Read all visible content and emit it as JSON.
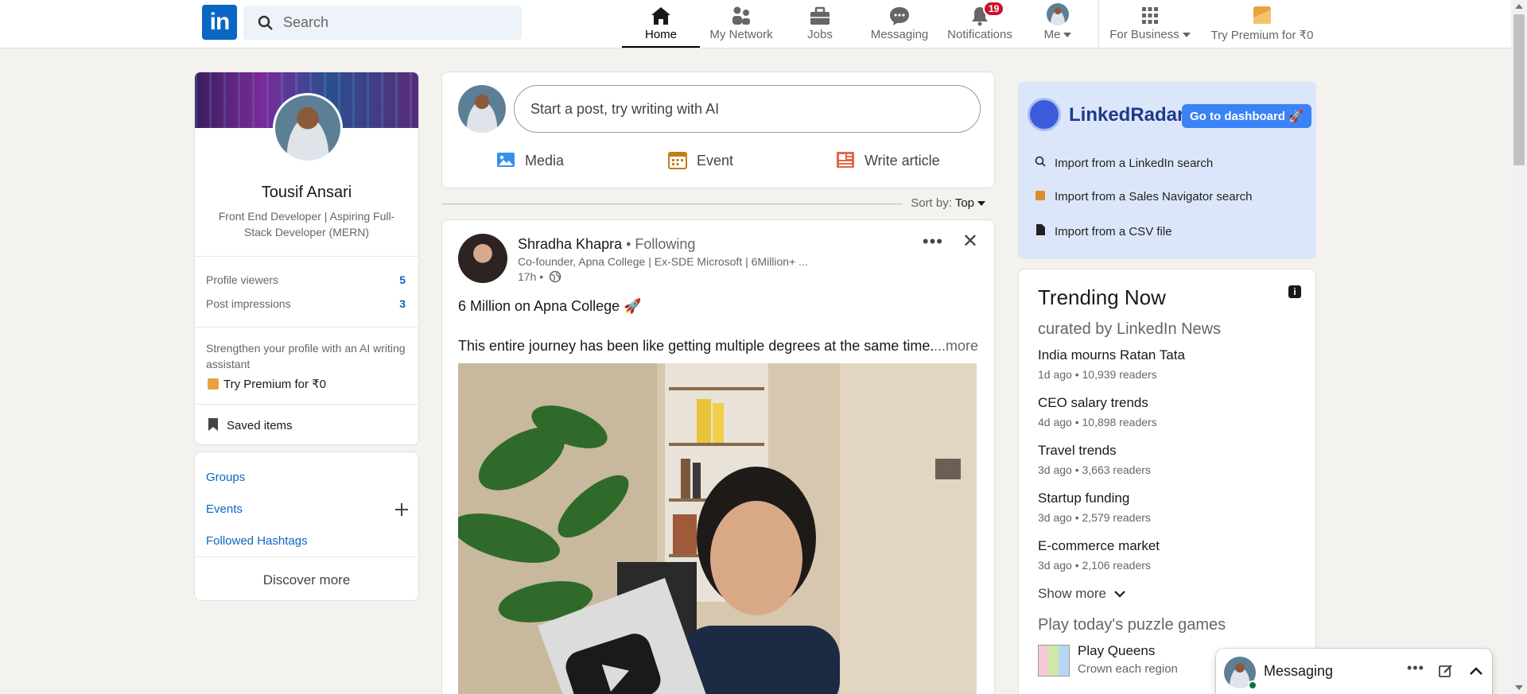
{
  "nav": {
    "logo": "in",
    "search_placeholder": "Search",
    "items": [
      {
        "label": "Home"
      },
      {
        "label": "My Network"
      },
      {
        "label": "Jobs"
      },
      {
        "label": "Messaging"
      },
      {
        "label": "Notifications",
        "badge": "19"
      },
      {
        "label": "Me"
      },
      {
        "label": "For Business"
      },
      {
        "label": "Try Premium for ₹0"
      }
    ]
  },
  "profile": {
    "name": "Tousif Ansari",
    "headline": "Front End Developer | Aspiring Full-Stack Developer (MERN)",
    "stats": [
      {
        "label": "Profile viewers",
        "value": "5"
      },
      {
        "label": "Post impressions",
        "value": "3"
      }
    ],
    "strengthen": "Strengthen your profile with an AI writing assistant",
    "premium": "Try Premium for ₹0",
    "saved": "Saved items"
  },
  "communities": {
    "links": [
      "Groups",
      "Events",
      "Followed Hashtags"
    ],
    "discover": "Discover more"
  },
  "share": {
    "prompt": "Start a post, try writing with AI",
    "actions": [
      "Media",
      "Event",
      "Write article"
    ]
  },
  "sort": {
    "label": "Sort by:",
    "value": "Top"
  },
  "post": {
    "author": "Shradha Khapra",
    "following": " • Following",
    "subtitle": "Co-founder, Apna College | Ex-SDE Microsoft | 6Million+ ...",
    "time": "17h •",
    "line1": "6 Million on Apna College 🚀",
    "line2": "This entire journey has been like getting multiple degrees at the same time.",
    "see_more": "...more"
  },
  "radar": {
    "name": "LinkedRadar",
    "dashboard": "Go to dashboard 🚀",
    "items": [
      "Import from a LinkedIn search",
      "Import from a Sales Navigator search",
      "Import from a CSV file"
    ]
  },
  "trending": {
    "title": "Trending Now",
    "subtitle": "curated by LinkedIn News",
    "items": [
      {
        "headline": "India mourns Ratan Tata",
        "meta": "1d ago • 10,939 readers"
      },
      {
        "headline": "CEO salary trends",
        "meta": "4d ago • 10,898 readers"
      },
      {
        "headline": "Travel trends",
        "meta": "3d ago • 3,663 readers"
      },
      {
        "headline": "Startup funding",
        "meta": "3d ago • 2,579 readers"
      },
      {
        "headline": "E-commerce market",
        "meta": "3d ago • 2,106 readers"
      }
    ],
    "show_more": "Show more",
    "puzzle_title": "Play today's puzzle games",
    "puzzle_name": "Play Queens",
    "puzzle_sub": "Crown each region"
  },
  "messaging": {
    "label": "Messaging"
  },
  "colors": {
    "brand": "#0a66c2",
    "badge": "#cb112d",
    "radar_bg": "#dce6fb"
  }
}
